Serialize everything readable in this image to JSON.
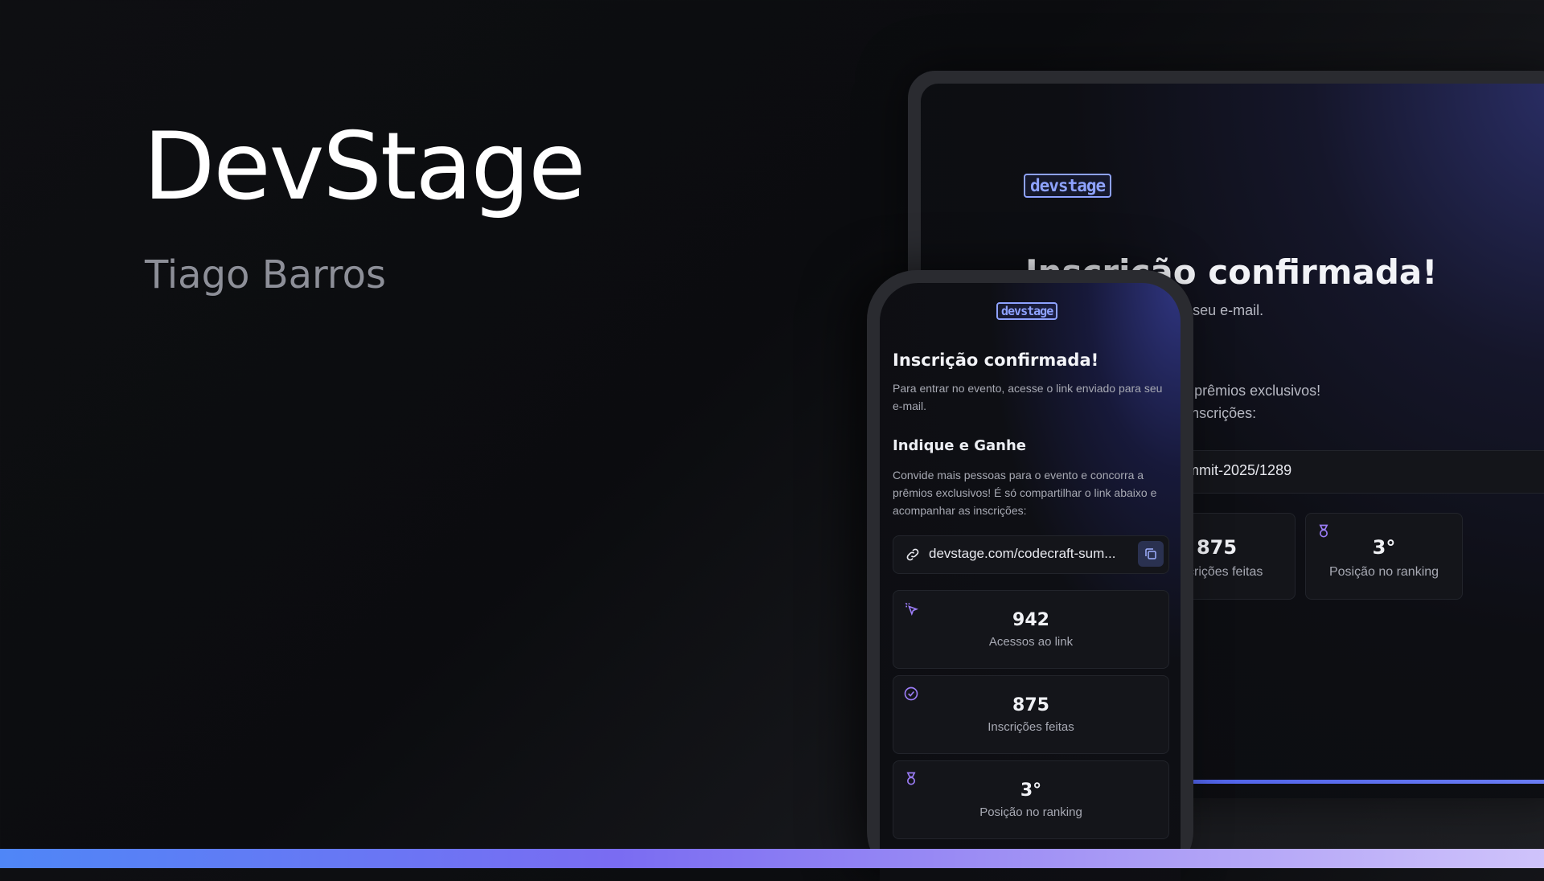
{
  "hero": {
    "title": "DevStage",
    "author": "Tiago Barros"
  },
  "logo_text": "devstage",
  "laptop": {
    "title": "Inscrição confirmada!",
    "subtitle": "cesse o link enviado para seu e-mail.",
    "invite_line1": "ara o evento e concorra a prêmios exclusivos!",
    "invite_line2": "abaixo e acompanhar as inscrições:",
    "link": "ecraft-summit-2025/1289",
    "stats": [
      {
        "value": "875",
        "label": "Inscrições feitas",
        "icon": "badge-check-icon"
      },
      {
        "value": "3°",
        "label": "Posição no ranking",
        "icon": "medal-icon"
      }
    ]
  },
  "phone": {
    "title": "Inscrição confirmada!",
    "subtitle": "Para entrar no evento, acesse o link enviado para seu e-mail.",
    "invite_title": "Indique e Ganhe",
    "invite_desc": "Convide mais pessoas para o evento e concorra a prêmios exclusivos! É só compartilhar o link abaixo e acompanhar as inscrições:",
    "link": "devstage.com/codecraft-sum...",
    "stats": [
      {
        "value": "942",
        "label": "Acessos ao link",
        "icon": "cursor-click-icon"
      },
      {
        "value": "875",
        "label": "Inscrições feitas",
        "icon": "badge-check-icon"
      },
      {
        "value": "3°",
        "label": "Posição no ranking",
        "icon": "medal-icon"
      }
    ]
  },
  "colors": {
    "accent": "#8ea2ff",
    "icon_purple": "#9b7cf6",
    "bar_start": "#4f86f7",
    "bar_end": "#cfc3fb"
  }
}
